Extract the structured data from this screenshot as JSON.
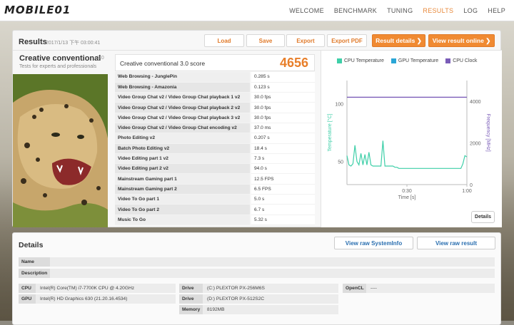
{
  "brand": {
    "logo_text": "MOBILE01"
  },
  "nav": {
    "items": [
      "WELCOME",
      "BENCHMARK",
      "TUNING",
      "RESULTS",
      "LOG",
      "HELP"
    ],
    "active_index": 3
  },
  "results": {
    "title": "Results",
    "date": "2017/1/13 下午 03:00:41",
    "buttons": {
      "load": "Load",
      "save": "Save",
      "export": "Export",
      "export_pdf": "Export PDF",
      "result_details": "Result details",
      "view_online": "View result online"
    }
  },
  "benchmark": {
    "name": "Creative conventional",
    "version": "3.0",
    "subtitle": "Tests for experts and professionals",
    "score_label": "Creative conventional 3.0 score",
    "score_value": "4656"
  },
  "subtests": [
    {
      "name": "Web Browsing - JunglePin",
      "value": "0.285 s"
    },
    {
      "name": "Web Browsing - Amazonia",
      "value": "0.123 s"
    },
    {
      "name": "Video Group Chat v2 / Video Group Chat playback 1 v2",
      "value": "30.0 fps"
    },
    {
      "name": "Video Group Chat v2 / Video Group Chat playback 2 v2",
      "value": "30.0 fps"
    },
    {
      "name": "Video Group Chat v2 / Video Group Chat playback 3 v2",
      "value": "30.0 fps"
    },
    {
      "name": "Video Group Chat v2 / Video Group Chat encoding v2",
      "value": "37.0 ms"
    },
    {
      "name": "Photo Editing v2",
      "value": "0.207 s"
    },
    {
      "name": "Batch Photo Editing v2",
      "value": "18.4 s"
    },
    {
      "name": "Video Editing part 1 v2",
      "value": "7.3 s"
    },
    {
      "name": "Video Editing part 2 v2",
      "value": "94.0 s"
    },
    {
      "name": "Mainstream Gaming part 1",
      "value": "12.5 FPS"
    },
    {
      "name": "Mainstream Gaming part 2",
      "value": "6.5 FPS"
    },
    {
      "name": "Video To Go part 1",
      "value": "5.0 s"
    },
    {
      "name": "Video To Go part 2",
      "value": "6.7 s"
    },
    {
      "name": "Music To Go",
      "value": "5.32 s"
    }
  ],
  "chart_data": {
    "type": "line",
    "legend": [
      "CPU Temperature",
      "GPU Temperature",
      "CPU Clock"
    ],
    "colors": {
      "cpu_temp": "#3ecfa8",
      "gpu_temp": "#2aa6d6",
      "cpu_clock": "#7a5cb8"
    },
    "ylabel_left": "Temperature [°C]",
    "ylabel_right": "Frequency [MHz]",
    "xlabel": "Time [s]",
    "x_ticks": [
      "0:30",
      "1:00"
    ],
    "y_left_ticks": [
      "50",
      "100"
    ],
    "y_right_ticks": [
      "0",
      "2000",
      "4000"
    ],
    "ylim_left": [
      30,
      120
    ],
    "ylim_right": [
      0,
      5000
    ],
    "xlim": [
      0,
      60
    ],
    "series": [
      {
        "name": "CPU Temperature",
        "x": [
          0,
          1,
          2,
          3,
          4,
          5,
          6,
          7,
          8,
          9,
          10,
          11,
          12,
          13,
          14,
          15,
          16,
          17,
          18,
          19,
          20,
          21,
          22,
          23,
          24,
          25,
          26,
          27,
          28,
          29,
          30,
          35,
          40,
          45,
          50,
          55,
          57,
          58,
          59,
          60
        ],
        "y": [
          55,
          47,
          46,
          48,
          64,
          50,
          47,
          57,
          47,
          56,
          47,
          58,
          47,
          46,
          46,
          46,
          46,
          46,
          68,
          46,
          46,
          46,
          46,
          46,
          45,
          45,
          44,
          44,
          44,
          44,
          44,
          44,
          44,
          44,
          44,
          44,
          44,
          48,
          55,
          54
        ]
      },
      {
        "name": "CPU Clock",
        "x": [
          0,
          60
        ],
        "y": [
          4200,
          4200
        ]
      }
    ]
  },
  "details": {
    "title": "Details",
    "view_raw_sysinfo": "View raw SystemInfo",
    "view_raw_result": "View raw result",
    "name_label": "Name",
    "name_value": "",
    "desc_label": "Description",
    "desc_value": "",
    "cpu_label": "CPU",
    "cpu_value": "Intel(R) Core(TM) i7-7700K CPU @ 4.20GHz",
    "gpu_label": "GPU",
    "gpu_value": "Intel(R) HD Graphics 630 (21.20.16.4534)",
    "drive_label": "Drive",
    "drive1_value": "(C:) PLEXTOR PX-256M6S",
    "drive2_value": "(D:) PLEXTOR PX-512S2C",
    "memory_label": "Memory",
    "memory_value": "8192MB",
    "opencl_label": "OpenCL",
    "opencl_value": "----"
  }
}
